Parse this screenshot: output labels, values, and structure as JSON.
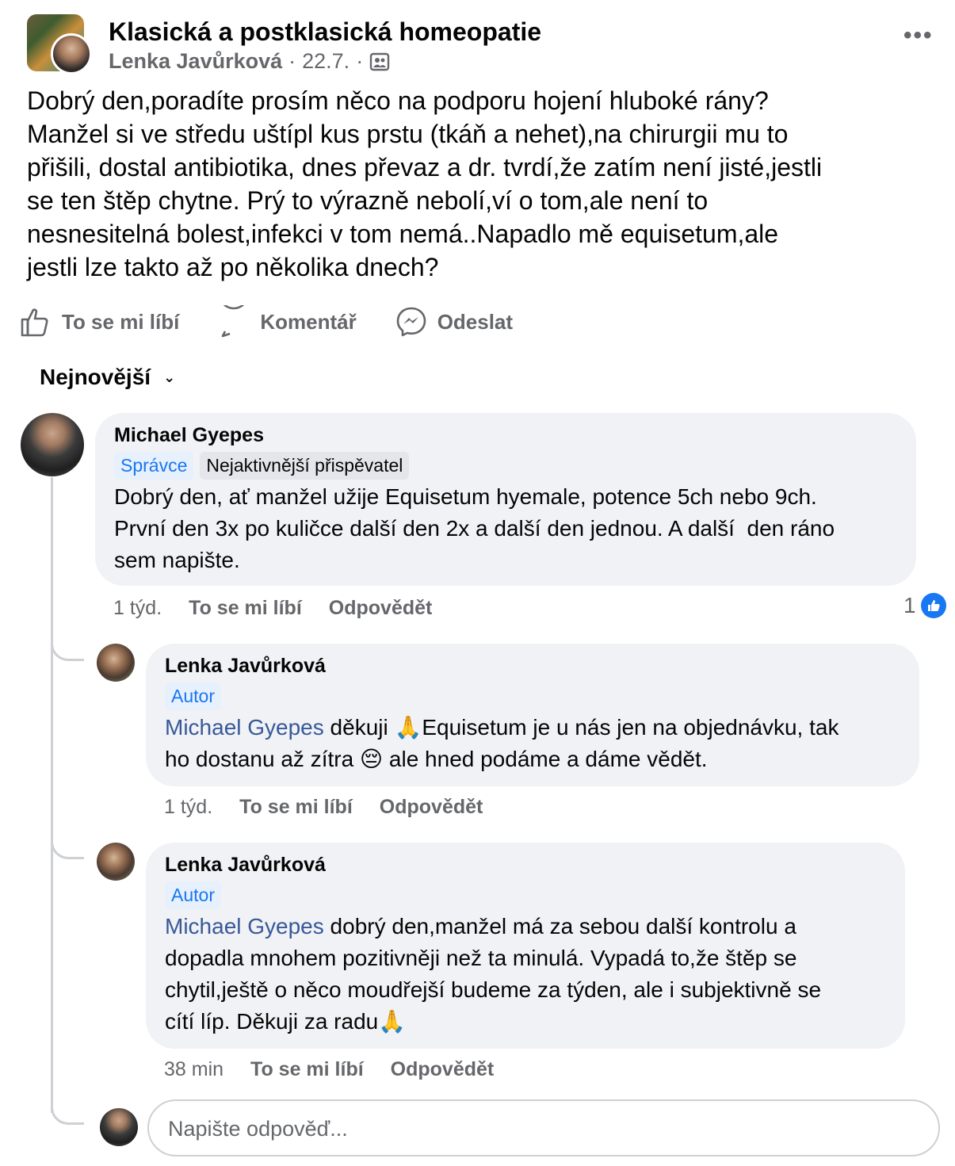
{
  "post": {
    "group_name": "Klasická a postklasická homeopatie",
    "author": "Lenka Javůrková",
    "date": "22.7.",
    "separator": "·",
    "audience_icon": "group-members-icon",
    "more_label": "•••",
    "text_lines": [
      "Dobrý den,poradíte prosím něco na podporu hojení hluboké rány?",
      "Manžel si ve středu uštípl kus prstu (tkáň a nehet),na chirurgii mu to",
      "přišili, dostal antibiotika, dnes převaz a dr. tvrdí,že zatím není jisté,jestli",
      "se ten štěp chytne. Prý to výrazně nebolí,ví o tom,ale není to",
      "nesnesitelná bolest,infekci v tom nemá..Napadlo mě equisetum,ale",
      "jestli lze takto až po několika dnech?"
    ]
  },
  "actions": {
    "like": "To se mi líbí",
    "comment": "Komentář",
    "send": "Odeslat"
  },
  "sort": {
    "label": "Nejnovější",
    "chevron": "⌄"
  },
  "comments": [
    {
      "author": "Michael Gyepes",
      "badges": [
        "Správce",
        "Nejaktivnější přispěvatel"
      ],
      "text_lines": [
        "Dobrý den, ať manžel užije Equisetum hyemale, potence 5ch nebo 9ch.",
        "První den 3x po kuličce další den 2x a další den jednou. A další  den ráno",
        "sem napište."
      ],
      "time": "1 týd.",
      "like": "To se mi líbí",
      "reply": "Odpovědět",
      "reaction_count": "1"
    },
    {
      "author": "Lenka Javůrková",
      "badge": "Autor",
      "mention": "Michael Gyepes",
      "line1_rest": " děkuji 🙏Equisetum je u nás jen na objednávku, tak",
      "line2": "ho dostanu až zítra 😔 ale hned podáme a dáme vědět.",
      "time": "1 týd.",
      "like": "To se mi líbí",
      "reply": "Odpovědět"
    },
    {
      "author": "Lenka Javůrková",
      "badge": "Autor",
      "mention": "Michael Gyepes",
      "line1_rest": " dobrý den,manžel má za sebou další kontrolu a",
      "lines": [
        "dopadla mnohem pozitivněji než ta minulá. Vypadá to,že štěp se",
        "chytil,ještě o něco moudřejší budeme za týden, ale i subjektivně se",
        "cítí líp. Děkuji za radu🙏"
      ],
      "time": "38 min",
      "like": "To se mi líbí",
      "reply": "Odpovědět"
    }
  ],
  "reply_input": {
    "placeholder": "Napište odpověď..."
  },
  "colors": {
    "meta_gray": "#65676b",
    "bubble_bg": "#f0f2f5",
    "link_blue": "#385898",
    "fb_blue": "#1877f2"
  }
}
